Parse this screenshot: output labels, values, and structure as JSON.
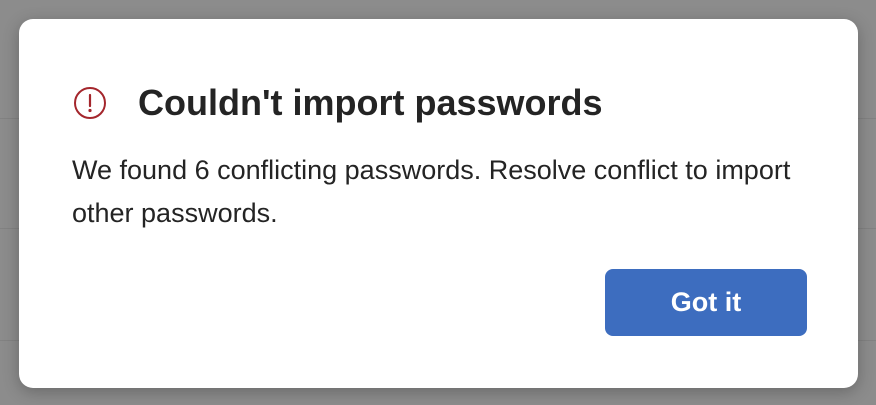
{
  "dialog": {
    "icon": "warning-circle-icon",
    "title": "Couldn't import passwords",
    "message": "We found 6 conflicting passwords. Resolve conflict to import other passwords.",
    "primary_button_label": "Got it"
  },
  "colors": {
    "accent": "#3d6dbf",
    "icon": "#a4262c",
    "backdrop": "#8c8c8c",
    "text": "#242424"
  }
}
